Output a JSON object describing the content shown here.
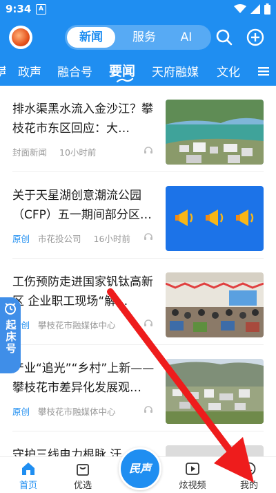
{
  "status_bar": {
    "time": "9:34",
    "badge": "A"
  },
  "header": {
    "segments": [
      "新闻",
      "服务",
      "AI"
    ],
    "active_segment": "新闻"
  },
  "tabs": [
    "政声",
    "融合号",
    "要闻",
    "天府融媒",
    "文化"
  ],
  "active_tab": "要闻",
  "feed": [
    {
      "title": "排水渠黑水流入金沙江？攀枝花市东区回应：大…",
      "original": "",
      "source": "封面新闻",
      "time": "10小时前",
      "thumb": "landscape-river"
    },
    {
      "title": "关于天星湖创意潮流公园（CFP）五一期间部分区…",
      "original": "原创",
      "source": "市花投公司",
      "time": "16小时前",
      "thumb": "megaphones"
    },
    {
      "title": "工伤预防走进国家钒钛高新区 企业职工现场“解…",
      "original": "原创",
      "source": "攀枝花市融媒体中心",
      "time": "",
      "thumb": "meeting-room"
    },
    {
      "title": "产业“追光”“乡村”上新——攀枝花市差异化发展观…",
      "original": "原创",
      "source": "攀枝花市融媒体中心",
      "time": "",
      "thumb": "village"
    },
    {
      "title": "守护三线电力根脉 汗…",
      "original": "",
      "source": "",
      "time": "",
      "thumb": "partial"
    }
  ],
  "float_badge": {
    "label": "起床号"
  },
  "bottom_nav": {
    "items": [
      "首页",
      "优选",
      "炫视频",
      "我的"
    ],
    "center_label": "民声",
    "active": "首页"
  },
  "colors": {
    "brand": "#1f8ef1",
    "arrow": "#ee1c1c"
  }
}
